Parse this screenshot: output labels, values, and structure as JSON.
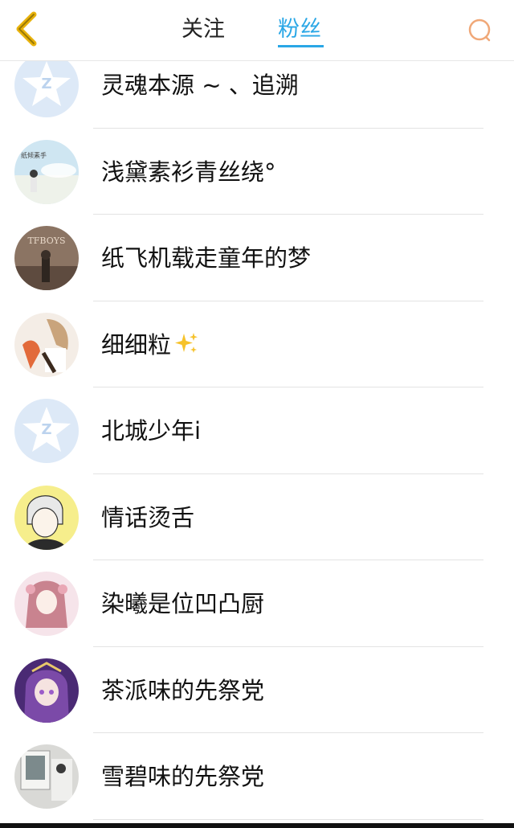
{
  "header": {
    "back_icon": "chevron-left-icon",
    "tabs": [
      {
        "label": "关注",
        "active": false
      },
      {
        "label": "粉丝",
        "active": true
      }
    ],
    "search_icon": "search-icon",
    "colors": {
      "accent": "#2aa7e6",
      "back": "#e8b20c",
      "search": "#f0a878"
    }
  },
  "fans": [
    {
      "name": "灵魂本源 ~ 、追溯",
      "avatar": "default-qq-avatar"
    },
    {
      "name": "浅黛素衫青丝绕°",
      "avatar": "girl-sky-avatar"
    },
    {
      "name": "纸飞机载走童年的梦",
      "avatar": "tfboys-avatar"
    },
    {
      "name": "细细粒",
      "avatar": "anime-avatar",
      "emoji": "sparkles-icon"
    },
    {
      "name": "北城少年i",
      "avatar": "default-qq-avatar"
    },
    {
      "name": "情话烫舌",
      "avatar": "anime-boy-avatar"
    },
    {
      "name": "染曦是位凹凸厨",
      "avatar": "anime-girl-pink-avatar"
    },
    {
      "name": "茶派味的先祭党",
      "avatar": "anime-girl-purple-avatar"
    },
    {
      "name": "雪碧味的先祭党",
      "avatar": "photo-avatar"
    }
  ]
}
